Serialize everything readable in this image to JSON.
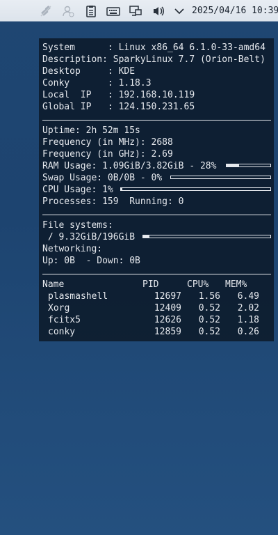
{
  "panel": {
    "clock": "2025/04/16 10:39",
    "icons": [
      "network-disabled-icon",
      "user-offline-icon",
      "clipboard-icon",
      "keyboard-icon",
      "display-icon",
      "volume-icon",
      "chevron-down-icon"
    ]
  },
  "conky": {
    "system_label": "System      :",
    "system_value": "Linux x86_64 6.1.0-33-amd64",
    "description_label": "Description:",
    "description_value": "SparkyLinux 7.7 (Orion-Belt)",
    "desktop_label": "Desktop     :",
    "desktop_value": "KDE",
    "conky_label": "Conky       :",
    "conky_value": "1.18.3",
    "local_ip_label": "Local  IP   :",
    "local_ip_value": "192.168.10.119",
    "global_ip_label": "Global IP   :",
    "global_ip_value": "124.150.231.65",
    "uptime": "Uptime: 2h 52m 15s",
    "freq_mhz": "Frequency (in MHz): 2688",
    "freq_ghz": "Frequency (in GHz): 2.69",
    "ram": "RAM Usage: 1.09GiB/3.82GiB - 28%",
    "ram_fraction": 0.28,
    "swap": "Swap Usage: 0B/0B - 0%",
    "swap_fraction": 0,
    "cpu": "CPU Usage: 1%",
    "cpu_fraction": 0.01,
    "processes": "Processes: 159  Running: 0",
    "fs_header": "File systems:",
    "fs_root": " / 9.32GiB/196GiB",
    "fs_fraction": 0.05,
    "net_header": "Networking:",
    "net_values": "Up: 0B  - Down: 0B",
    "table": {
      "headers": {
        "name": "Name",
        "pid": "PID",
        "cpu": "CPU%",
        "mem": "MEM%"
      },
      "rows": [
        {
          "name": "plasmashell",
          "pid": "12697",
          "cpu": "1.56",
          "mem": "6.49"
        },
        {
          "name": "Xorg",
          "pid": "12409",
          "cpu": "0.52",
          "mem": "2.02"
        },
        {
          "name": "fcitx5",
          "pid": "12626",
          "cpu": "0.52",
          "mem": "1.18"
        },
        {
          "name": "conky",
          "pid": "12859",
          "cpu": "0.52",
          "mem": "0.26"
        }
      ]
    }
  }
}
